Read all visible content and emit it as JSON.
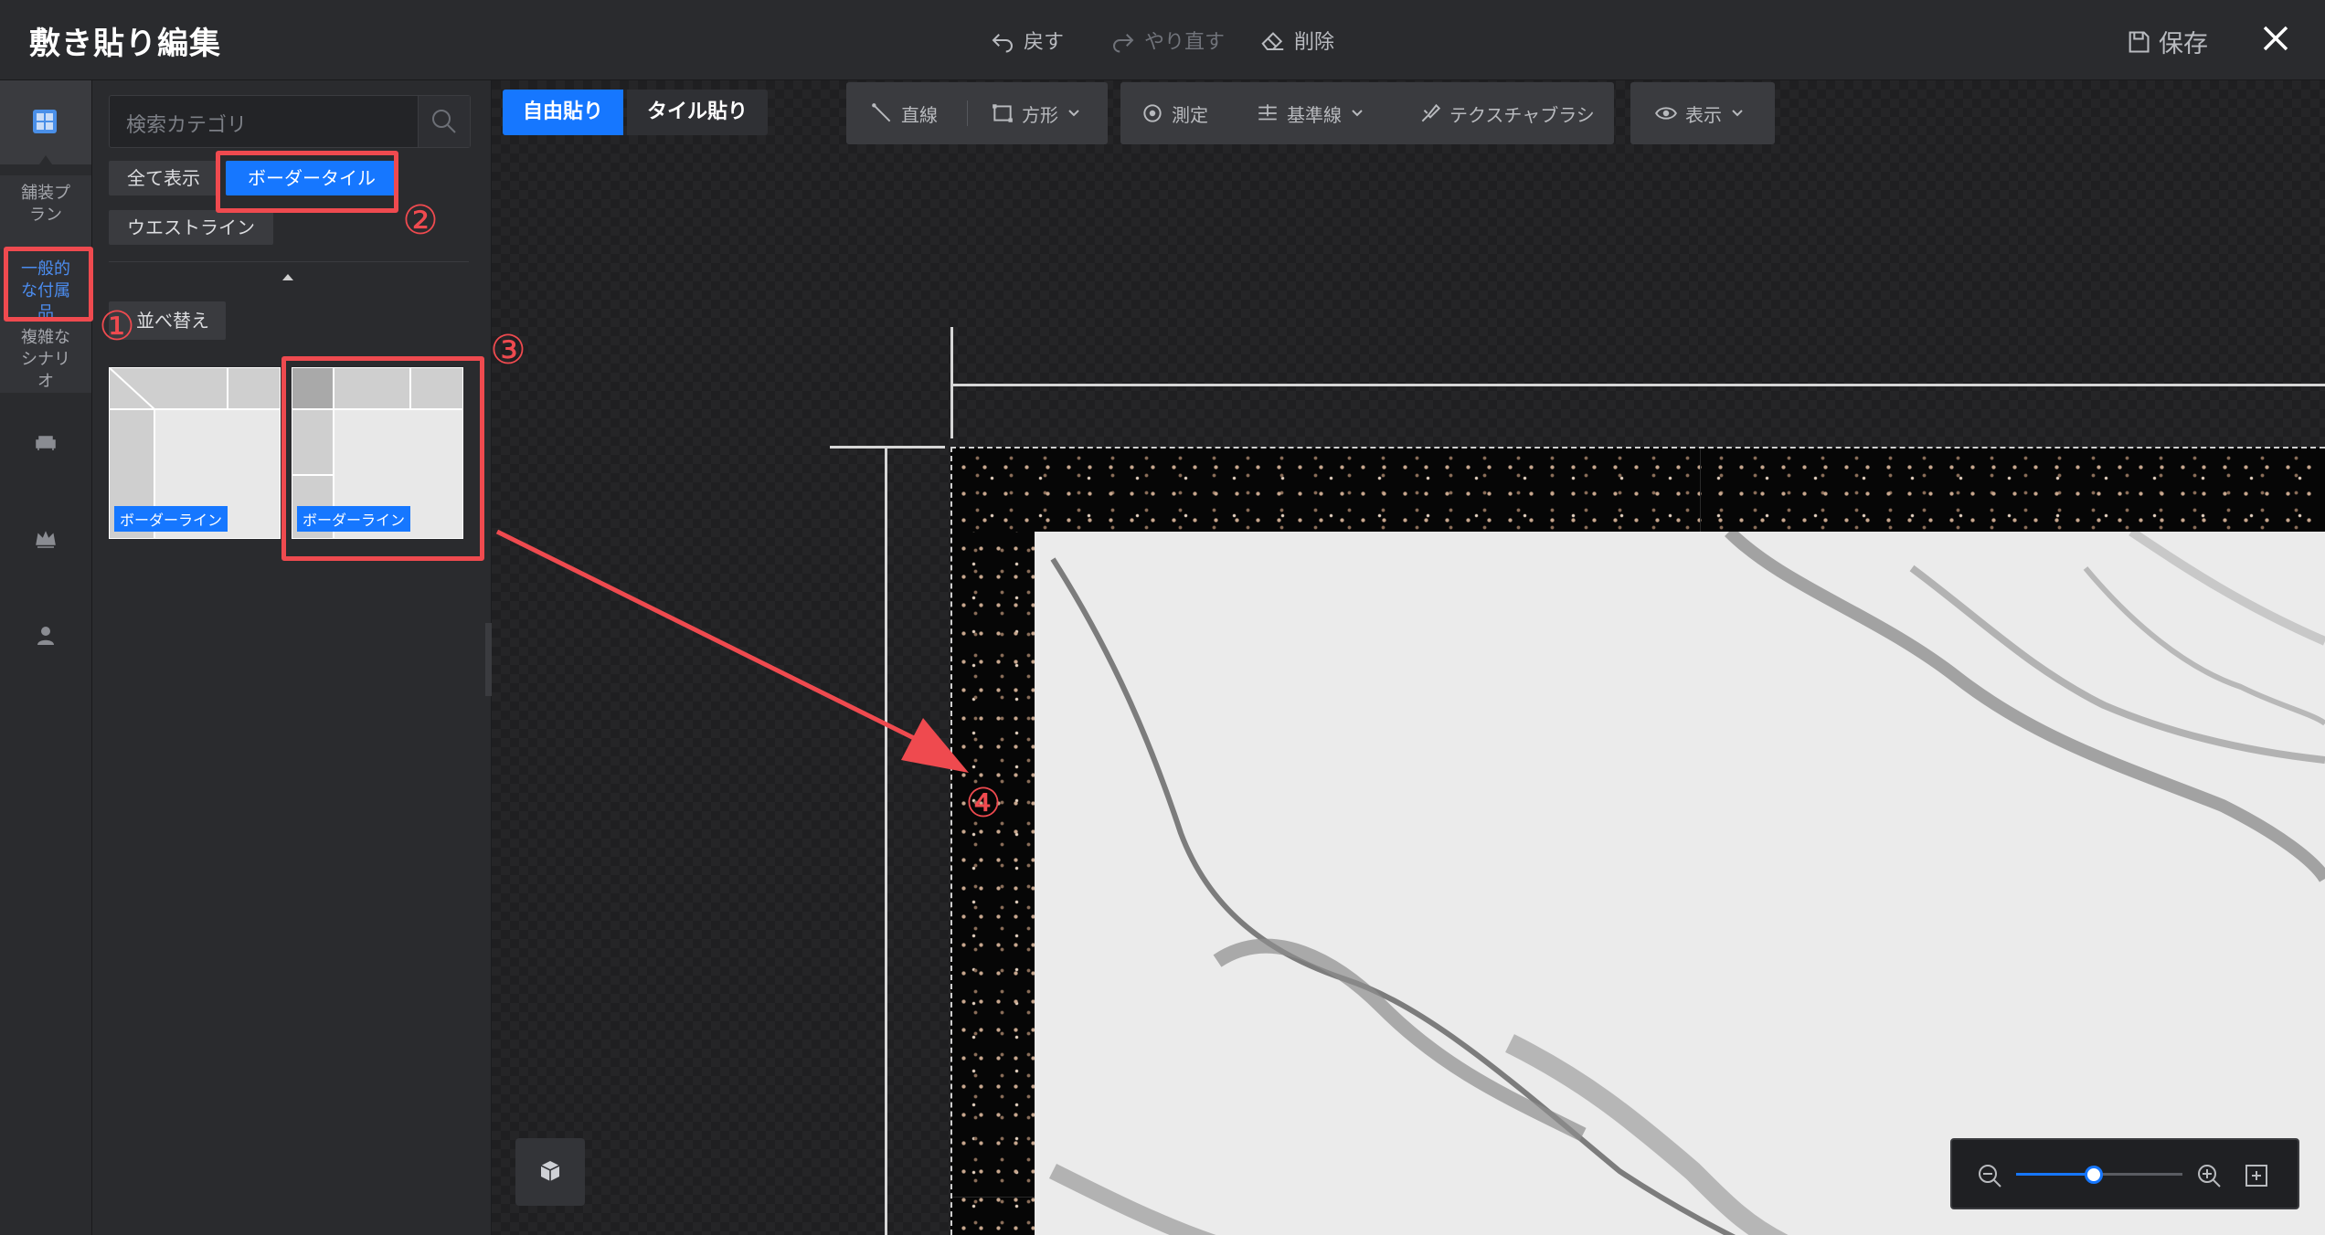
{
  "window": {
    "title": "敷き貼り編集",
    "undo_label": "戻す",
    "redo_label": "やり直す",
    "delete_label": "削除",
    "save_label": "保存"
  },
  "rail": {
    "categories": [
      {
        "label": "舗装プラン",
        "state": "normal"
      },
      {
        "label": "一般的な付属品",
        "state": "active"
      },
      {
        "label": "複雑なシナリオ",
        "state": "normal"
      }
    ],
    "icons": [
      "tile-grid-icon",
      "sofa-icon",
      "crown-icon",
      "user-icon"
    ]
  },
  "panel": {
    "search_placeholder": "検索カテゴリ",
    "filters": [
      {
        "label": "全て表示",
        "selected": false
      },
      {
        "label": "ボーダータイル",
        "selected": true
      },
      {
        "label": "ウエストライン",
        "selected": false
      }
    ],
    "sort_label": "並べ替え",
    "items": [
      {
        "tag": "ボーダーライン"
      },
      {
        "tag": "ボーダーライン"
      }
    ]
  },
  "toolbar": {
    "modes": [
      {
        "label": "自由貼り",
        "active": true
      },
      {
        "label": "タイル貼り",
        "active": false
      }
    ],
    "draw_tools": [
      {
        "label": "直線",
        "icon": "line-icon"
      },
      {
        "label": "方形",
        "icon": "rectangle-icon"
      }
    ],
    "measure_tools": [
      {
        "label": "測定",
        "icon": "measure-icon"
      },
      {
        "label": "基準線",
        "icon": "baseline-icon"
      },
      {
        "label": "テクスチャブラシ",
        "icon": "texture-brush-icon"
      }
    ],
    "view_label": "表示"
  },
  "zoom": {
    "level": 0.45
  },
  "annotations": {
    "markers": [
      "①",
      "②",
      "③",
      "④"
    ],
    "color": "#ef4a4f"
  },
  "colors": {
    "accent": "#1677ff",
    "annotation": "#ef4a4f",
    "background": "#1b1c1f"
  }
}
